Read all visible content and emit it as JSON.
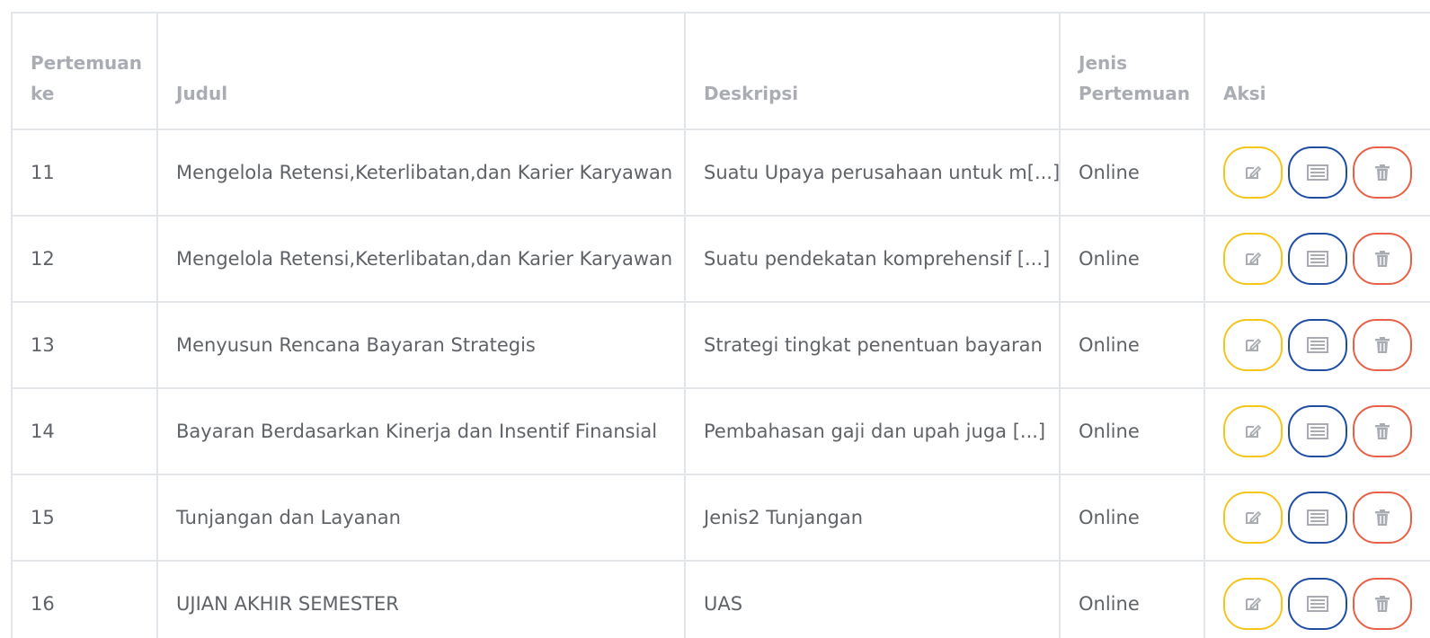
{
  "table": {
    "headers": {
      "pertemuan": "Pertemuan ke",
      "judul": "Judul",
      "deskripsi": "Deskripsi",
      "jenis": "Jenis Pertemuan",
      "aksi": "Aksi"
    },
    "rows": [
      {
        "pertemuan": "11",
        "judul": "Mengelola Retensi,Keterlibatan,dan Karier Karyawan",
        "deskripsi": "Suatu Upaya perusahaan untuk m[...]",
        "jenis": "Online"
      },
      {
        "pertemuan": "12",
        "judul": "Mengelola Retensi,Keterlibatan,dan Karier Karyawan",
        "deskripsi": "Suatu pendekatan komprehensif [...]",
        "jenis": "Online"
      },
      {
        "pertemuan": "13",
        "judul": "Menyusun Rencana Bayaran Strategis",
        "deskripsi": "Strategi tingkat penentuan bayaran",
        "jenis": "Online"
      },
      {
        "pertemuan": "14",
        "judul": "Bayaran Berdasarkan Kinerja dan Insentif Finansial",
        "deskripsi": "Pembahasan gaji dan upah juga [...]",
        "jenis": "Online"
      },
      {
        "pertemuan": "15",
        "judul": "Tunjangan dan Layanan",
        "deskripsi": "Jenis2 Tunjangan",
        "jenis": "Online"
      },
      {
        "pertemuan": "16",
        "judul": "UJIAN AKHIR SEMESTER",
        "deskripsi": "UAS",
        "jenis": "Online"
      }
    ],
    "actions": {
      "edit_icon": "edit-icon",
      "detail_icon": "list-icon",
      "delete_icon": "trash-icon"
    }
  },
  "colors": {
    "edit": "#f4c51d",
    "detail": "#1e4ea3",
    "delete": "#e8604a",
    "header_text": "#a9adb3",
    "body_text": "#5f6368",
    "border": "#e2e5ea"
  }
}
